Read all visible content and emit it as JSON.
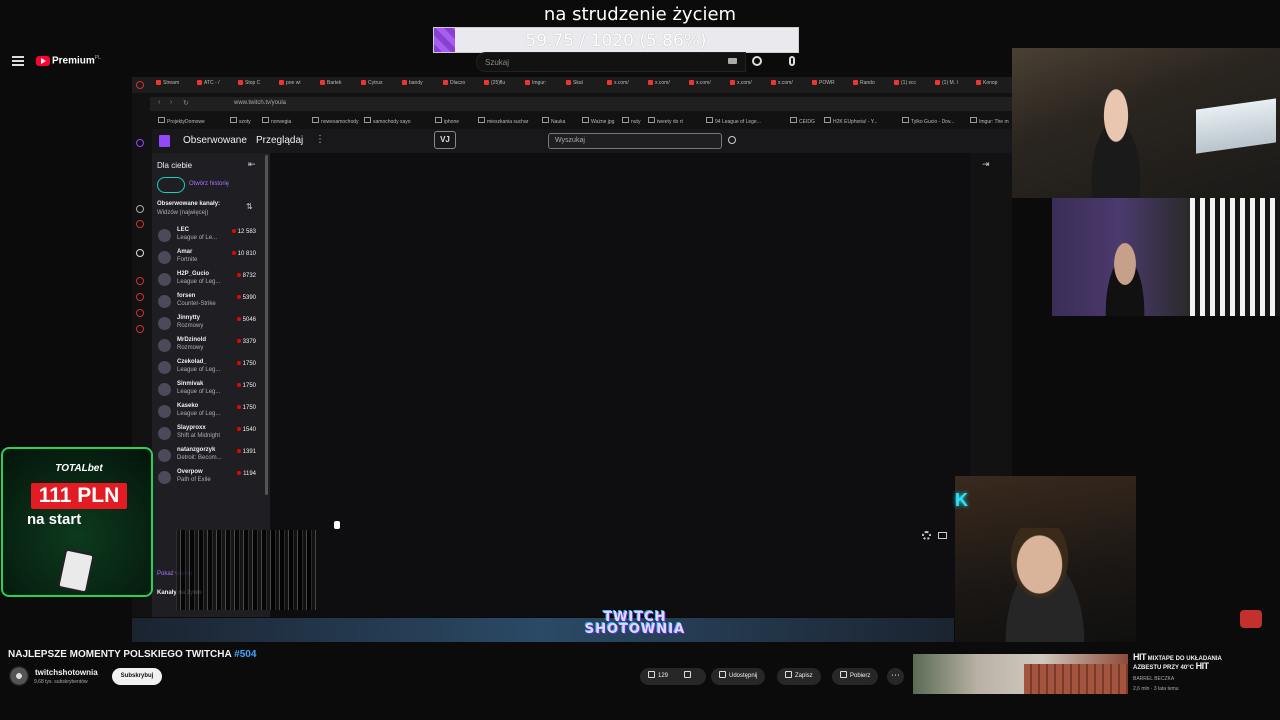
{
  "goal": {
    "title": "na strudzenie życiem",
    "progress_text": "59.75 / 1020 (5.86%)",
    "percent": 5.86,
    "fill_color": "#8a3fd1"
  },
  "yt_header": {
    "brand": "Premium",
    "brand_region": "PL",
    "search_placeholder": "Szukaj"
  },
  "browser": {
    "tabs": [
      "Stream",
      "ATC - /",
      "Stop C",
      "poe wi",
      "Bartek",
      "Cytrus",
      "bandy",
      "Dlaczo",
      "(25)flu",
      "Imgur:",
      "Skal",
      "x.com/",
      "x.com/",
      "x.com/",
      "x.com/",
      "x.com/",
      "POWR",
      "Rando",
      "(1) xcc",
      "(1) M. I",
      "Konop"
    ],
    "url": "www.twitch.tv/youla",
    "bookmarks": [
      "ProjektyDomowe",
      "szoty",
      "norwegia",
      "nowesamochody",
      "samochody xayo",
      "iphone",
      "mieszkania suchar",
      "Nauka",
      "Ważne jpg",
      "nuty",
      "tweety do rt",
      "94 League of Lege...",
      "CEIDG",
      "H2K EUphoria! - Y...",
      "Tylko Gucio - Dov...",
      "Imgur: The m"
    ]
  },
  "twitch": {
    "nav_following": "Obserwowane",
    "nav_browse": "Przeglądaj",
    "more": "⋮",
    "badge": "VJ",
    "search_placeholder": "Wyszukaj",
    "sidebar": {
      "heading": "Dla ciebie",
      "history_label": "Otwórz historię",
      "followed_heading": "Obserwowane kanały:",
      "followed_sort": "Widzów (najwięcej)",
      "channels": [
        {
          "name": "LEC",
          "game": "League of Le...",
          "viewers": "12 583"
        },
        {
          "name": "Amar",
          "game": "Fortnite",
          "viewers": "10 810"
        },
        {
          "name": "H2P_Gucio",
          "game": "League of Leg...",
          "viewers": "8732"
        },
        {
          "name": "forsen",
          "game": "Counter-Strike",
          "viewers": "5390"
        },
        {
          "name": "Jinnytty",
          "game": "Rozmowy",
          "viewers": "5046"
        },
        {
          "name": "MrDzinold",
          "game": "Rozmowy",
          "viewers": "3379"
        },
        {
          "name": "Czekolad_",
          "game": "League of Leg...",
          "viewers": "1750"
        },
        {
          "name": "Sinmivak",
          "game": "League of Leg...",
          "viewers": "1750"
        },
        {
          "name": "Kaseko",
          "game": "League of Leg...",
          "viewers": "1750"
        },
        {
          "name": "Slayproxx",
          "game": "Shift at Midnight",
          "viewers": "1540"
        },
        {
          "name": "natanzgorzyk",
          "game": "Detroit: Becom...",
          "viewers": "1391"
        },
        {
          "name": "Overpow",
          "game": "Path of Exile",
          "viewers": "1194"
        }
      ],
      "show_more": "Pokaż więcej",
      "live_heading": "Kanały na żywo"
    }
  },
  "brand_overlay": {
    "line1": "TWITCH",
    "line2": "SHOTOWNIA"
  },
  "ad": {
    "brand": "TOTALbet",
    "amount": "111 PLN",
    "sub": "na start"
  },
  "yt_video": {
    "title": "NAJLEPSZE MOMENTY POLSKIEGO TWITCHA",
    "tag": "#504",
    "channel": "twitchshotownia",
    "subs": "9,68 tys. subskrybentów",
    "subscribe": "Subskrybuj",
    "likes": "129",
    "share": "Udostępnij",
    "save": "Zapisz",
    "download": "Pobierz"
  },
  "recommended": {
    "hit_left": "HIT",
    "title_line1": "MIXTAPE DO UKŁADANIA",
    "title_line2": "AZBESTU PRZY 40°C",
    "hit_right": "HIT",
    "channel": "BARREL BECZKA",
    "meta": "2,6 mln · 3 lata temu"
  }
}
